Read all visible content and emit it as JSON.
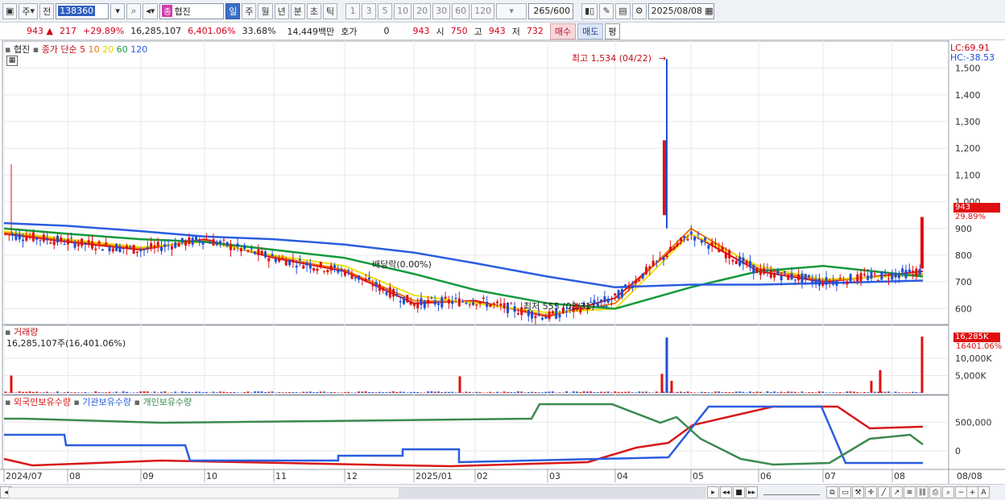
{
  "toolbar": {
    "market": "주",
    "period_prefix": "전",
    "code": "138360",
    "name_tag": "종",
    "name": "협진",
    "periods": [
      "일",
      "주",
      "월",
      "년",
      "분",
      "초",
      "틱"
    ],
    "active_period": "일",
    "intervals": [
      "1",
      "3",
      "5",
      "10",
      "20",
      "30",
      "60",
      "120"
    ],
    "count": "265",
    "count_total": "/600",
    "date": "2025/08/08"
  },
  "quote": {
    "price": "943",
    "change": "217",
    "change_pct": "+29.89%",
    "volume": "16,285,107",
    "volume_pct": "6,401.06%",
    "turnover": "33.68%",
    "amount": "14,449백만",
    "bid_label": "호가",
    "bid_value": "0",
    "cur": "943",
    "open_label": "시",
    "open": "750",
    "high_label": "고",
    "high": "943",
    "low_label": "저",
    "low": "732",
    "buy": "매수",
    "sell": "매도",
    "avg": "평"
  },
  "price_pane": {
    "title": "협진",
    "ma_label": "종가 단순",
    "ma_periods": [
      "5",
      "10",
      "20",
      "60",
      "120"
    ],
    "lc": "LC:69.91",
    "hc": "HC:-38.53",
    "y_ticks": [
      "1,500",
      "1,400",
      "1,300",
      "1,200",
      "1,100",
      "1,000",
      "900",
      "800",
      "700",
      "600"
    ],
    "current_price": "943",
    "current_pct": "29.89%",
    "annot_high": "최고 1,534 (04/22)",
    "annot_low": "최저 555 (03/31)",
    "annot_event": "배당락(0.00%)"
  },
  "volume_pane": {
    "title": "거래량",
    "summary": "16,285,107주(16,401.06%)",
    "y_ticks": [
      "10,000K",
      "5,000K"
    ],
    "current": "16,285K",
    "current_pct": "16401.06%"
  },
  "holding_pane": {
    "series": [
      "외국인보유수량",
      "기관보유수량",
      "개인보유수량"
    ],
    "y_ticks": [
      "500,000",
      "0"
    ]
  },
  "x_axis": [
    "2024/07",
    "08",
    "09",
    "10",
    "11",
    "12",
    "2025/01",
    "02",
    "03",
    "04",
    "05",
    "06",
    "07",
    "08"
  ],
  "x_axis_right": "08/08",
  "colors": {
    "ma5": "#e01010",
    "ma10": "#f07800",
    "ma20": "#f0e010",
    "ma60": "#129a3a",
    "ma120": "#2a5de0",
    "up": "#e01010",
    "down": "#1f4ed8",
    "foreign": "#d81818",
    "inst": "#2a5de0",
    "indiv": "#3a8a50"
  },
  "chart_data": {
    "type": "line",
    "x": [
      "2024/07",
      "08",
      "09",
      "10",
      "11",
      "12",
      "2025/01",
      "02",
      "03",
      "04",
      "05",
      "06",
      "07",
      "08"
    ],
    "series": [
      {
        "name": "5",
        "values": [
          880,
          850,
          820,
          860,
          790,
          740,
          620,
          630,
          570,
          640,
          880,
          740,
          700,
          740
        ]
      },
      {
        "name": "10",
        "values": [
          885,
          855,
          825,
          855,
          795,
          745,
          630,
          625,
          575,
          620,
          900,
          750,
          705,
          730
        ]
      },
      {
        "name": "20",
        "values": [
          890,
          860,
          830,
          850,
          800,
          760,
          650,
          620,
          585,
          600,
          880,
          760,
          710,
          725
        ]
      },
      {
        "name": "60",
        "values": [
          900,
          880,
          860,
          850,
          820,
          790,
          730,
          670,
          620,
          600,
          680,
          740,
          760,
          720
        ]
      },
      {
        "name": "120",
        "values": [
          920,
          910,
          890,
          870,
          860,
          840,
          810,
          770,
          720,
          680,
          690,
          690,
          695,
          705
        ]
      }
    ],
    "ylim": [
      555,
      1534
    ]
  }
}
